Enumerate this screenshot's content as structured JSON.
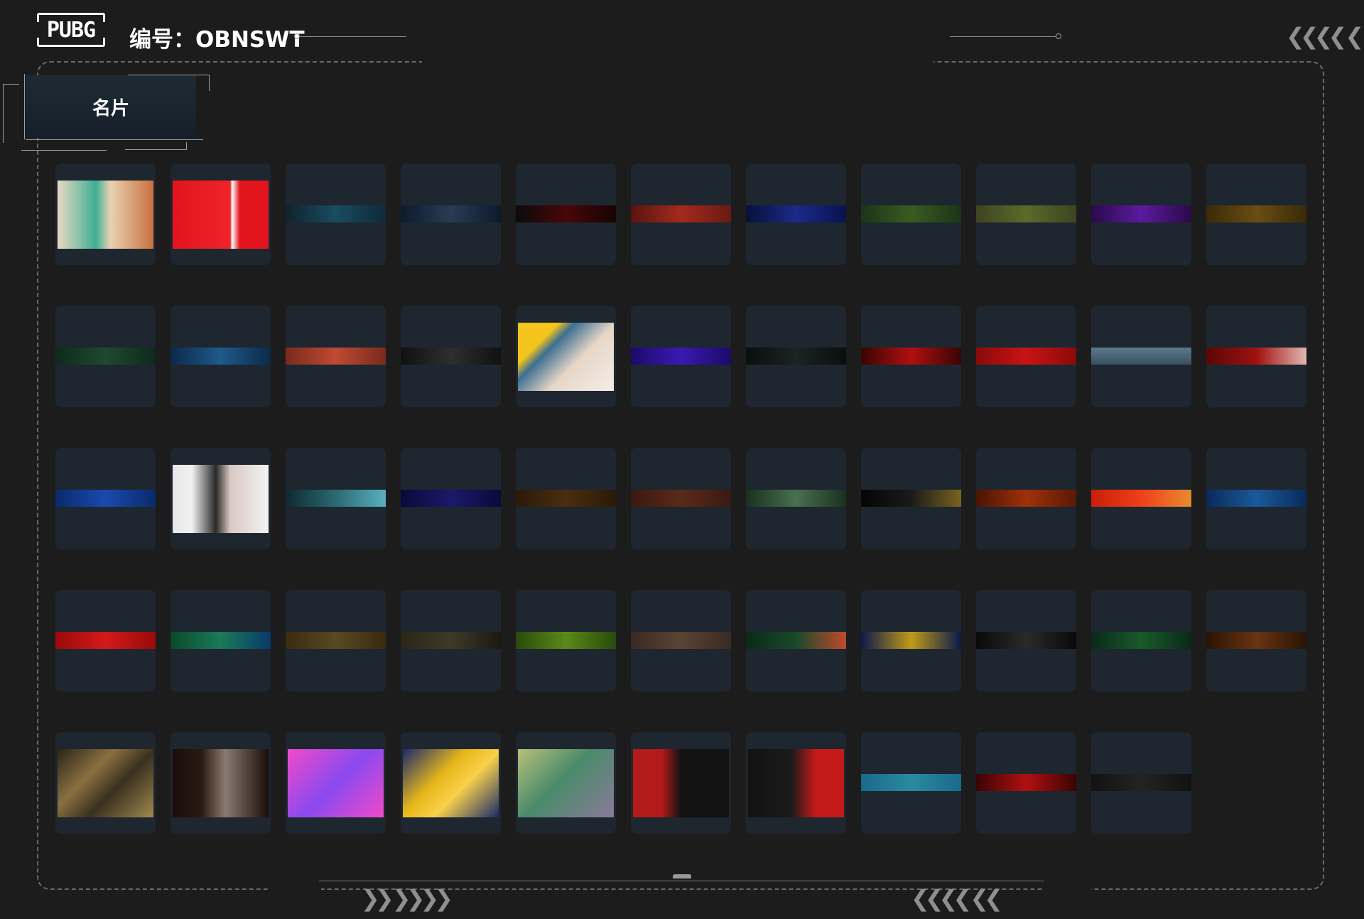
{
  "header": {
    "logo_text": "PUBG",
    "id_label": "编号：OBNSWT",
    "top_right_chevrons": "❮❮❮❮ ❮"
  },
  "tab": {
    "label": "名片"
  },
  "footer": {
    "left_chevrons": "❯❯ ❯❯❯❯",
    "right_chevrons": "❮❮❮❮ ❮❮"
  },
  "cards": [
    {
      "kind": "photo",
      "bg": "linear-gradient(90deg,#e9d9c4 0%,#3fae93 40%,#e8d2b2 55%,#c8703f 100%)"
    },
    {
      "kind": "photo",
      "bg": "linear-gradient(90deg,#e3141c 0%,#f0232a 60%,#ffffff 62%,#e3141c 70%)"
    },
    {
      "kind": "strip",
      "bg": "linear-gradient(90deg,#10222d,#1a4c62,#0f2a38)"
    },
    {
      "kind": "strip",
      "bg": "linear-gradient(90deg,#0c1a2c,#2a3c55,#0c1a2c)"
    },
    {
      "kind": "strip",
      "bg": "linear-gradient(90deg,#0b0b0b,#4a0608,#170404)"
    },
    {
      "kind": "strip",
      "bg": "linear-gradient(90deg,#5a1410,#a42a1c,#6a1a12)"
    },
    {
      "kind": "strip",
      "bg": "linear-gradient(90deg,#08103a,#1b2a8a,#0a1250)"
    },
    {
      "kind": "strip",
      "bg": "linear-gradient(90deg,#1c3418,#3a5c22,#1c3418)"
    },
    {
      "kind": "strip",
      "bg": "linear-gradient(90deg,#3e4420,#5c6a2a,#3e4420)"
    },
    {
      "kind": "strip",
      "bg": "linear-gradient(90deg,#2a0a4a,#5c1aa0,#2a0a4a)"
    },
    {
      "kind": "strip",
      "bg": "linear-gradient(90deg,#3a2a08,#6a4e12,#3a2a08)"
    },
    {
      "kind": "strip",
      "bg": "linear-gradient(90deg,#0e2a1c,#1e4a2e,#0e2a1c)"
    },
    {
      "kind": "strip",
      "bg": "linear-gradient(90deg,#0c2a4a,#1e5a8a,#0c2a4a)"
    },
    {
      "kind": "strip",
      "bg": "linear-gradient(90deg,#7a2a1c,#c04a32,#7a2a1c)"
    },
    {
      "kind": "strip",
      "bg": "linear-gradient(90deg,#111,#2e2e2e,#111)"
    },
    {
      "kind": "photo",
      "bg": "linear-gradient(135deg,#f4c41c 0%,#f4c41c 25%,#3c6f92 35%,#e8d6c6 60%,#f2eee8 100%)"
    },
    {
      "kind": "strip",
      "bg": "linear-gradient(90deg,#1c0a6a,#3a1ab0,#1c0a6a)"
    },
    {
      "kind": "strip",
      "bg": "linear-gradient(90deg,#0a0e0e,#1c2424,#0a0e0e)"
    },
    {
      "kind": "strip",
      "bg": "linear-gradient(90deg,#3a0404,#b01010,#3a0404)"
    },
    {
      "kind": "strip",
      "bg": "linear-gradient(90deg,#8a0a0a,#c81414,#8a0a0a)"
    },
    {
      "kind": "strip",
      "bg": "linear-gradient(180deg,#5a7a8a,#3a5060)"
    },
    {
      "kind": "strip",
      "bg": "linear-gradient(90deg,#5a0808,#a01010,#e2b8b0)"
    },
    {
      "kind": "strip",
      "bg": "linear-gradient(90deg,#0a2a6a,#1a4ab0,#0a2a6a)"
    },
    {
      "kind": "photo",
      "bg": "linear-gradient(90deg,#e8e8e8 0%,#f0f0f0 20%,#2a2a2a 45%,#d8c8c0 60%,#f4f4f4 100%)"
    },
    {
      "kind": "strip",
      "bg": "linear-gradient(90deg,#0e2a2e,#2a6a72,#5ab0c0)"
    },
    {
      "kind": "strip",
      "bg": "linear-gradient(90deg,#0a0a3a,#1a1a6a,#0a0a3a)"
    },
    {
      "kind": "strip",
      "bg": "linear-gradient(90deg,#2a1a08,#4a2e10,#2a1a08)"
    },
    {
      "kind": "strip",
      "bg": "linear-gradient(90deg,#3a1a12,#5a2a18,#3a1a12)"
    },
    {
      "kind": "strip",
      "bg": "linear-gradient(90deg,#1a3020,#4a7050,#1a3020)"
    },
    {
      "kind": "strip",
      "bg": "linear-gradient(90deg,#050505,#1a1a1a,#7a6420)"
    },
    {
      "kind": "strip",
      "bg": "linear-gradient(90deg,#4a1404,#a0300a,#5a1a06)"
    },
    {
      "kind": "strip",
      "bg": "linear-gradient(90deg,#c81e0a,#f0401a,#e88a30)"
    },
    {
      "kind": "strip",
      "bg": "linear-gradient(90deg,#0a2a5a,#1a5a9a,#0a2a5a)"
    },
    {
      "kind": "strip",
      "bg": "linear-gradient(90deg,#9a0a0a,#d41a1a,#9a0a0a)"
    },
    {
      "kind": "strip",
      "bg": "linear-gradient(90deg,#0a4a2a,#1a7a5a,#0a3a6a)"
    },
    {
      "kind": "strip",
      "bg": "linear-gradient(90deg,#3a2a10,#5a4a20,#3a2a10)"
    },
    {
      "kind": "strip",
      "bg": "linear-gradient(90deg,#2a2618,#3e3a28,#1a1a14)"
    },
    {
      "kind": "strip",
      "bg": "linear-gradient(90deg,#2a4a0a,#5a8a1a,#2a4a0a)"
    },
    {
      "kind": "strip",
      "bg": "linear-gradient(90deg,#3a2a22,#5a4434,#3a2a22)"
    },
    {
      "kind": "strip",
      "bg": "linear-gradient(90deg,#0a2a1a,#1a4a2a,#c04a2a)"
    },
    {
      "kind": "strip",
      "bg": "linear-gradient(90deg,#0a1a4a,#c09a1a,#0a1a4a)"
    },
    {
      "kind": "strip",
      "bg": "linear-gradient(90deg,#0a0a0a,#2a2a2a,#0a0a0a)"
    },
    {
      "kind": "strip",
      "bg": "linear-gradient(90deg,#0a2a1a,#1a5a2a,#0a2a1a)"
    },
    {
      "kind": "strip",
      "bg": "linear-gradient(90deg,#2a1406,#6a3410,#2a1406)"
    },
    {
      "kind": "photo",
      "bg": "linear-gradient(135deg,#2a2418 0%,#8a7040 35%,#3a3020 60%,#a08a50 100%)"
    },
    {
      "kind": "photo",
      "bg": "linear-gradient(90deg,#1a0e0a 0%,#2a1a12 30%,#8a7a70 55%,#1a0e0a 100%)"
    },
    {
      "kind": "photo",
      "bg": "linear-gradient(135deg,#f04ac8 0%,#8a4af0 50%,#f04ac8 100%)"
    },
    {
      "kind": "photo",
      "bg": "linear-gradient(135deg,#1a2a6a 0%,#e8b81a 40%,#f8d04a 60%,#1a2a6a 100%)"
    },
    {
      "kind": "photo",
      "bg": "linear-gradient(135deg,#b8c07a 0%,#4a8a6a 45%,#8a7a9a 100%)"
    },
    {
      "kind": "photo",
      "bg": "linear-gradient(90deg,#b41a1a 0%,#b41a1a 30%,#121212 50%,#121212 100%)"
    },
    {
      "kind": "photo",
      "bg": "linear-gradient(90deg,#121212 0%,#1a1a1a 45%,#c41a1a 70%,#c41a1a 100%)"
    },
    {
      "kind": "strip",
      "bg": "linear-gradient(90deg,#1a6a8a,#2a8aa0,#1a6a8a)"
    },
    {
      "kind": "strip",
      "bg": "linear-gradient(90deg,#3a0404,#b01010,#3a0404)"
    },
    {
      "kind": "strip",
      "bg": "linear-gradient(90deg,#121212,#242424,#121212)"
    }
  ]
}
